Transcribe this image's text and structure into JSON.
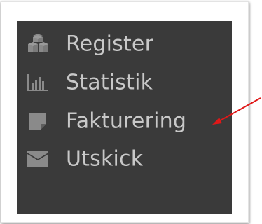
{
  "menu": {
    "items": [
      {
        "label": "Register",
        "icon": "cubes-icon"
      },
      {
        "label": "Statistik",
        "icon": "bar-chart-icon"
      },
      {
        "label": "Fakturering",
        "icon": "sticky-note-icon"
      },
      {
        "label": "Utskick",
        "icon": "envelope-icon"
      }
    ]
  },
  "colors": {
    "menu_background": "#3a3a3a",
    "text": "#c8c8c8",
    "icon": "#8a8a8a",
    "annotation_arrow": "#e01818"
  }
}
